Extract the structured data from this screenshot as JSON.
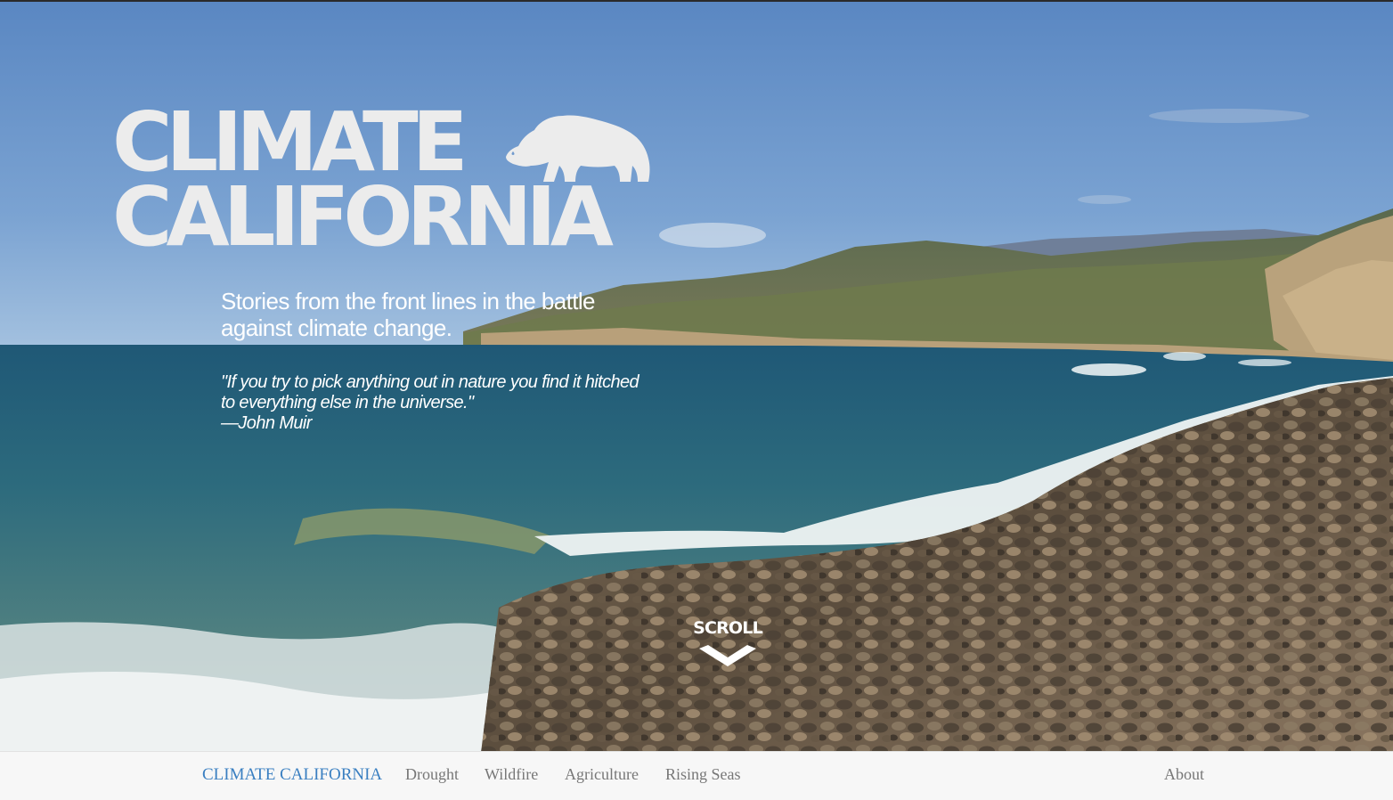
{
  "hero": {
    "logo_line1": "CLIMATE",
    "logo_line2": "CALIFORNIA",
    "logo_icon": "bear-icon",
    "tagline": "Stories from the front lines in the battle against climate change.",
    "quote_line1": "\"If you try to pick anything out in nature you find it hitched",
    "quote_line2": "to everything else in the universe.\"",
    "quote_author": "—John Muir",
    "scroll_label": "SCROLL",
    "scroll_icon": "chevron-down-icon"
  },
  "nav": {
    "brand": "CLIMATE CALIFORNIA",
    "items": [
      {
        "label": "Drought"
      },
      {
        "label": "Wildfire"
      },
      {
        "label": "Agriculture"
      },
      {
        "label": "Rising Seas"
      }
    ],
    "about": "About"
  },
  "colors": {
    "brand_blue": "#3a7fc1",
    "nav_text": "#777777",
    "nav_bg": "#f7f7f7",
    "logo": "#ececec"
  }
}
